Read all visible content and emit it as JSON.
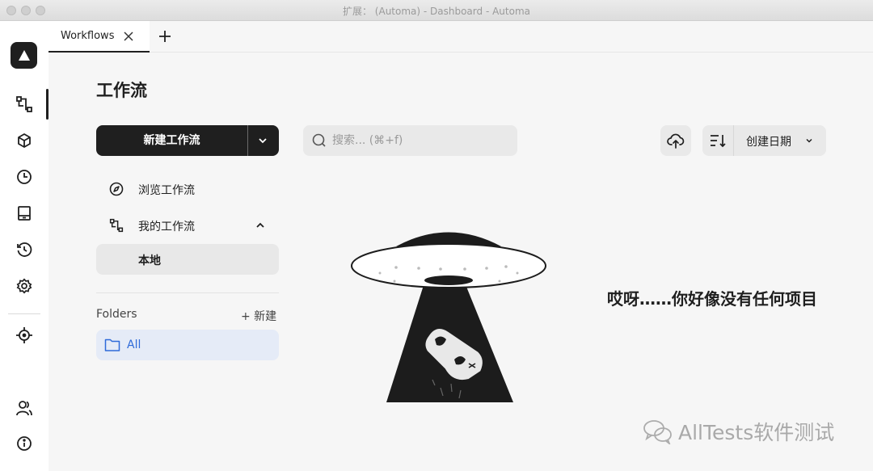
{
  "window": {
    "title": "扩展： (Automa) - Dashboard - Automa"
  },
  "tabs": [
    {
      "label": "Workflows"
    }
  ],
  "rail": {
    "icons": [
      "automa-logo-icon",
      "workflows-icon",
      "packages-icon",
      "schedule-icon",
      "storage-icon",
      "logs-icon",
      "settings-icon",
      "element-picker-icon",
      "profile-icon",
      "about-icon"
    ]
  },
  "page": {
    "title": "工作流"
  },
  "sidebar": {
    "new_button": "新建工作流",
    "browse": "浏览工作流",
    "my_workflows": "我的工作流",
    "local": "本地",
    "folders_label": "Folders",
    "new_folder": "+ 新建",
    "folder_all": "All"
  },
  "search": {
    "placeholder": "搜索... (⌘+f)"
  },
  "sort": {
    "selected": "创建日期"
  },
  "empty": {
    "message": "哎呀……你好像没有任何项目"
  },
  "watermark": {
    "text": "AllTests软件测试"
  }
}
